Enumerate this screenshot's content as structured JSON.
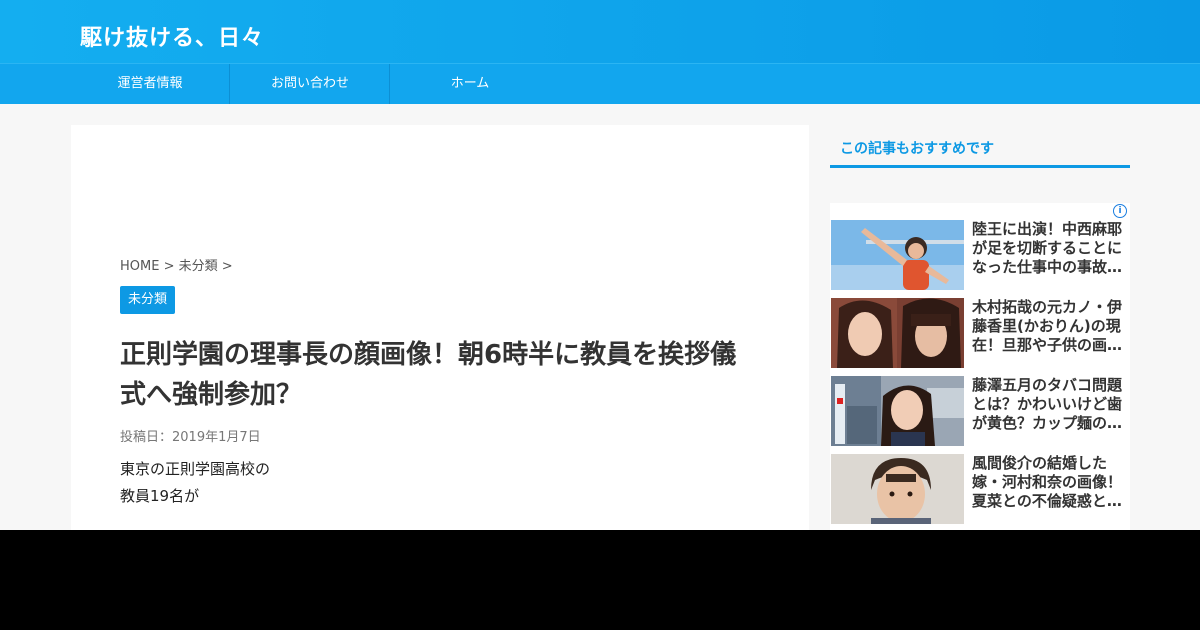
{
  "header": {
    "site_title": "駆け抜ける、日々"
  },
  "nav": {
    "items": [
      {
        "label": "運営者情報"
      },
      {
        "label": "お問い合わせ"
      },
      {
        "label": "ホーム"
      }
    ]
  },
  "article": {
    "breadcrumb": {
      "home": "HOME",
      "sep1": " > ",
      "category": "未分類",
      "sep2": " >"
    },
    "category_badge": "未分類",
    "title": "正則学園の理事長の顔画像！朝6時半に教員を挨拶儀式へ強制参加？",
    "date": "投稿日：2019年1月7日",
    "body": [
      "東京の正則学園高校の",
      "教員19名が"
    ]
  },
  "sidebar": {
    "heading": "この記事もおすすめです",
    "ad_info_icon": "info-icon",
    "items": [
      {
        "title": "陸王に出演！中西麻耶が足を切断することになった仕事中の事故とは？"
      },
      {
        "title": "木村拓哉の元カノ・伊藤香里(かおりん)の現在！旦那や子供の画像は？"
      },
      {
        "title": "藤澤五月のタバコ問題とは？かわいいけど歯が黄色？カップ麺の噂も"
      },
      {
        "title": "風間俊介の結婚した嫁・河村和奈の画像！夏菜との不倫疑惑とは？"
      }
    ]
  },
  "colors": {
    "accent": "#0d99e4",
    "header": "#14aef0"
  }
}
